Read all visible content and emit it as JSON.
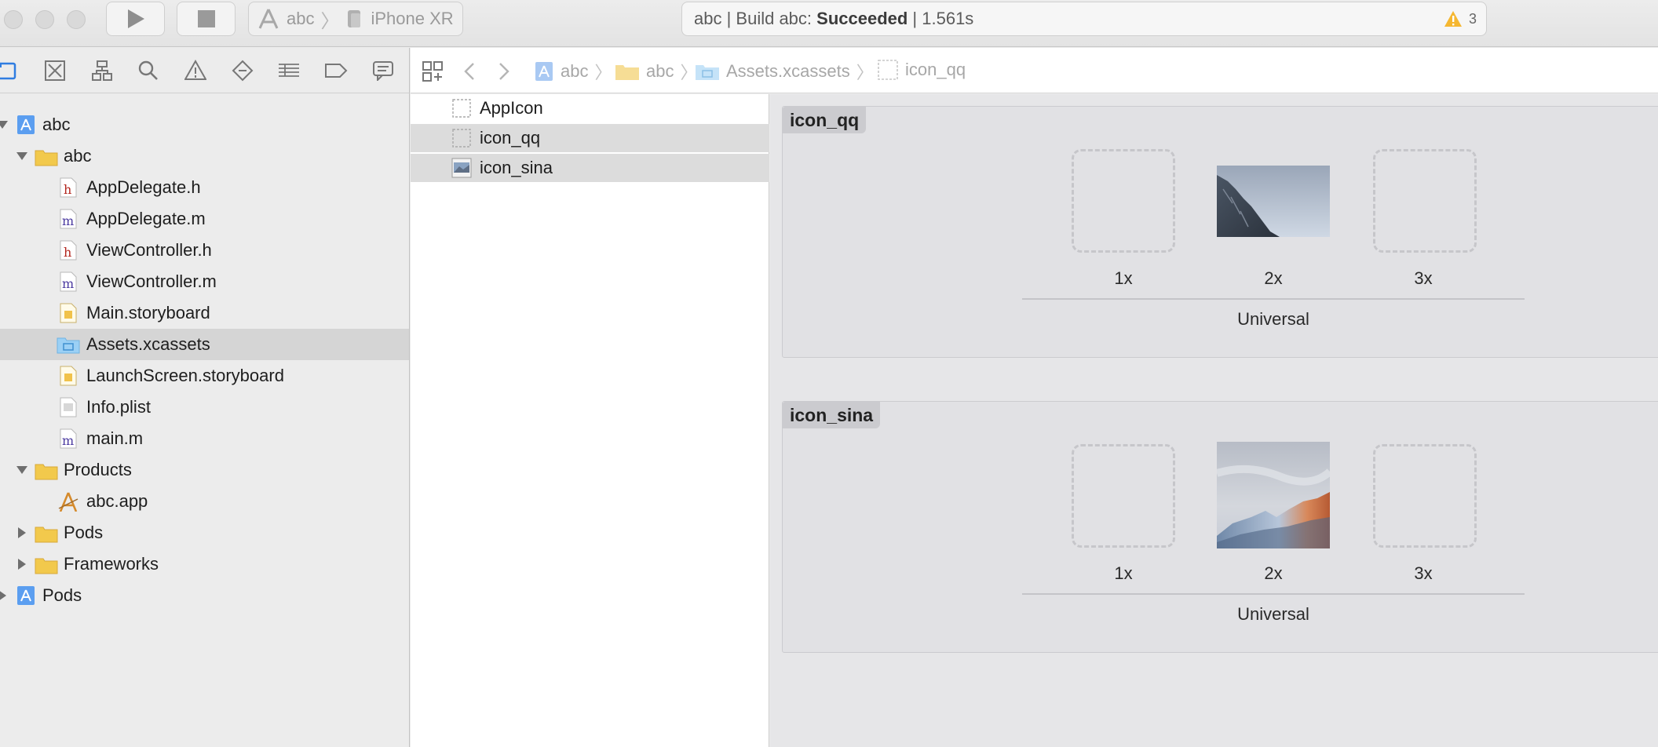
{
  "toolbar": {
    "scheme_app": "abc",
    "scheme_device": "iPhone XR",
    "activity_prefix": "abc | Build abc: ",
    "activity_status": "Succeeded",
    "activity_suffix": " | 1.561s",
    "warning_count": "3"
  },
  "navigator": {
    "tabs": [
      "project-navigator-icon",
      "source-control-icon",
      "symbol-navigator-icon",
      "find-icon",
      "issue-icon",
      "test-icon",
      "debug-icon",
      "breakpoint-icon",
      "report-icon"
    ],
    "items": [
      {
        "label": "abc",
        "icon": "project-icon",
        "level": 0,
        "disclosure": "open"
      },
      {
        "label": "abc",
        "icon": "folder-icon",
        "level": 1,
        "disclosure": "open"
      },
      {
        "label": "AppDelegate.h",
        "icon": "header-file-icon",
        "level": 2
      },
      {
        "label": "AppDelegate.m",
        "icon": "objc-file-icon",
        "level": 2
      },
      {
        "label": "ViewController.h",
        "icon": "header-file-icon",
        "level": 2
      },
      {
        "label": "ViewController.m",
        "icon": "objc-file-icon",
        "level": 2
      },
      {
        "label": "Main.storyboard",
        "icon": "storyboard-icon",
        "level": 2
      },
      {
        "label": "Assets.xcassets",
        "icon": "asset-catalog-icon",
        "level": 2,
        "selected": true
      },
      {
        "label": "LaunchScreen.storyboard",
        "icon": "storyboard-icon",
        "level": 2
      },
      {
        "label": "Info.plist",
        "icon": "plist-icon",
        "level": 2
      },
      {
        "label": "main.m",
        "icon": "objc-file-icon",
        "level": 2
      },
      {
        "label": "Products",
        "icon": "folder-icon",
        "level": 1,
        "disclosure": "open"
      },
      {
        "label": "abc.app",
        "icon": "app-icon",
        "level": 2
      },
      {
        "label": "Pods",
        "icon": "folder-icon",
        "level": 1,
        "disclosure": "closed"
      },
      {
        "label": "Frameworks",
        "icon": "folder-icon",
        "level": 1,
        "disclosure": "closed"
      },
      {
        "label": "Pods",
        "icon": "project-icon",
        "level": 0,
        "disclosure": "closed"
      }
    ]
  },
  "jumpbar": {
    "crumbs": [
      "abc",
      "abc",
      "Assets.xcassets",
      "icon_qq"
    ]
  },
  "assets": {
    "items": [
      {
        "label": "AppIcon",
        "icon": "empty-image-set-icon"
      },
      {
        "label": "icon_qq",
        "icon": "empty-image-set-icon",
        "selected": true
      },
      {
        "label": "icon_sina",
        "icon": "image-set-icon",
        "selected": true
      }
    ]
  },
  "sets": [
    {
      "title": "icon_qq",
      "scales": [
        "1x",
        "2x",
        "3x"
      ],
      "device": "Universal",
      "image": "mountain-cliff-image"
    },
    {
      "title": "icon_sina",
      "scales": [
        "1x",
        "2x",
        "3x"
      ],
      "device": "Universal",
      "image": "mountain-sunset-image"
    }
  ],
  "colors": {
    "warning": "#f5b731",
    "selection": "#d5d5d5",
    "folder": "#f2c94c"
  }
}
